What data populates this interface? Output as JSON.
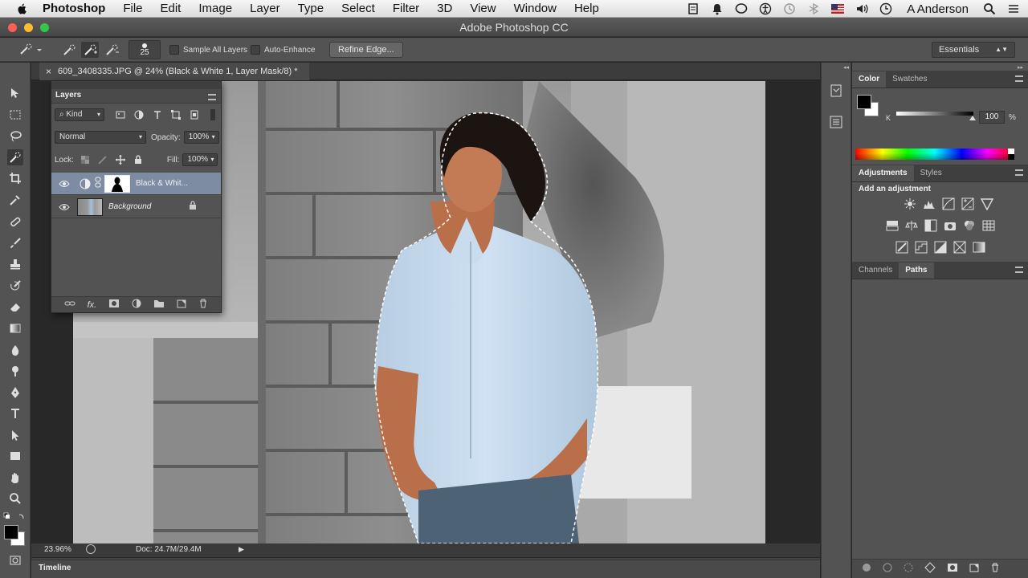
{
  "menubar": {
    "app_name": "Photoshop",
    "items": [
      "File",
      "Edit",
      "Image",
      "Layer",
      "Type",
      "Select",
      "Filter",
      "3D",
      "View",
      "Window",
      "Help"
    ],
    "user": "A Anderson"
  },
  "window": {
    "title": "Adobe Photoshop CC"
  },
  "options": {
    "brush_size": "25",
    "sample_all_layers": "Sample All Layers",
    "auto_enhance": "Auto-Enhance",
    "refine_edge": "Refine Edge...",
    "workspace": "Essentials"
  },
  "document": {
    "tab_title": "609_3408335.JPG @ 24% (Black & White 1, Layer Mask/8) *",
    "zoom": "23.96%",
    "doc_size": "Doc: 24.7M/29.4M"
  },
  "layers_panel": {
    "title": "Layers",
    "filter_kind": "Kind",
    "blend_mode": "Normal",
    "opacity_label": "Opacity:",
    "opacity": "100%",
    "lock_label": "Lock:",
    "fill_label": "Fill:",
    "fill": "100%",
    "layers": [
      {
        "name": "Black & Whit...",
        "selected": true
      },
      {
        "name": "Background",
        "selected": false
      }
    ]
  },
  "color_panel": {
    "tabs": [
      "Color",
      "Swatches"
    ],
    "channel": "K",
    "value": "100",
    "unit": "%"
  },
  "adjustments_panel": {
    "tabs": [
      "Adjustments",
      "Styles"
    ],
    "heading": "Add an adjustment"
  },
  "paths_panel": {
    "tabs": [
      "Channels",
      "Paths"
    ]
  },
  "timeline": {
    "label": "Timeline"
  },
  "colors": {
    "selection_bg": "#7d8ba3",
    "ui_dark": "#535353"
  }
}
